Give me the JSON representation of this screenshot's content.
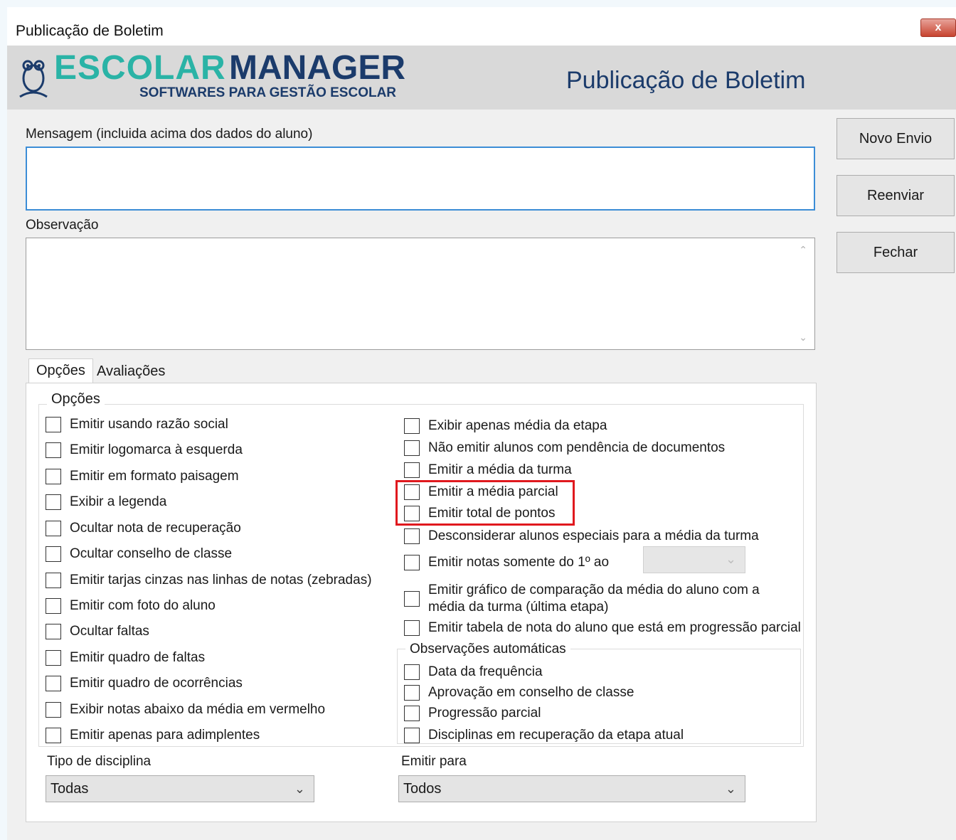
{
  "window": {
    "title": "Publicação de Boletim",
    "close_label": "x"
  },
  "header": {
    "brand_part1": "ESCOLAR",
    "brand_part2": "MANAGER",
    "slogan": "SOFTWARES PARA GESTÃO ESCOLAR",
    "title": "Publicação de Boletim"
  },
  "form": {
    "message_label": "Mensagem (incluida acima dos dados do aluno)",
    "message_value": "",
    "observation_label": "Observação",
    "observation_value": ""
  },
  "buttons": {
    "new_send": "Novo Envio",
    "resend": "Reenviar",
    "close": "Fechar"
  },
  "tabs": [
    "Opções",
    "Avaliações"
  ],
  "options": {
    "group_title": "Opções",
    "left": [
      "Emitir usando razão social",
      "Emitir logomarca à esquerda",
      "Emitir em formato paisagem",
      "Exibir a legenda",
      "Ocultar nota de recuperação",
      "Ocultar conselho de classe",
      "Emitir tarjas cinzas nas linhas de notas (zebradas)",
      "Emitir com foto do aluno",
      "Ocultar faltas",
      "Emitir quadro de faltas",
      "Emitir quadro de ocorrências",
      "Exibir notas abaixo da média em vermelho",
      "Emitir apenas para adimplentes"
    ],
    "right": [
      "Exibir apenas média da etapa",
      "Não emitir alunos com pendência de documentos",
      "Emitir a média da turma",
      "Emitir a média parcial",
      "Emitir total de pontos",
      "Desconsiderar alunos especiais para a média da turma",
      "Emitir notas somente do 1º ao",
      "Emitir gráfico de comparação da média do aluno com a",
      "média da turma (última etapa)",
      "Emitir tabela de nota do aluno que está em progressão parcial"
    ],
    "auto_obs_title": "Observações automáticas",
    "auto_obs": [
      "Data da frequência",
      "Aprovação em conselho de classe",
      "Progressão parcial",
      "Disciplinas em recuperação da etapa atual"
    ],
    "discipline_type_label": "Tipo de disciplina",
    "discipline_type_value": "Todas",
    "emit_for_label": "Emitir para",
    "emit_for_value": "Todos",
    "up_to_value": ""
  },
  "colors": {
    "brand_teal": "#2ab3a6",
    "brand_navy": "#1b3b6b",
    "highlight_red": "#e0191e",
    "focus_blue": "#3c8dd6"
  }
}
